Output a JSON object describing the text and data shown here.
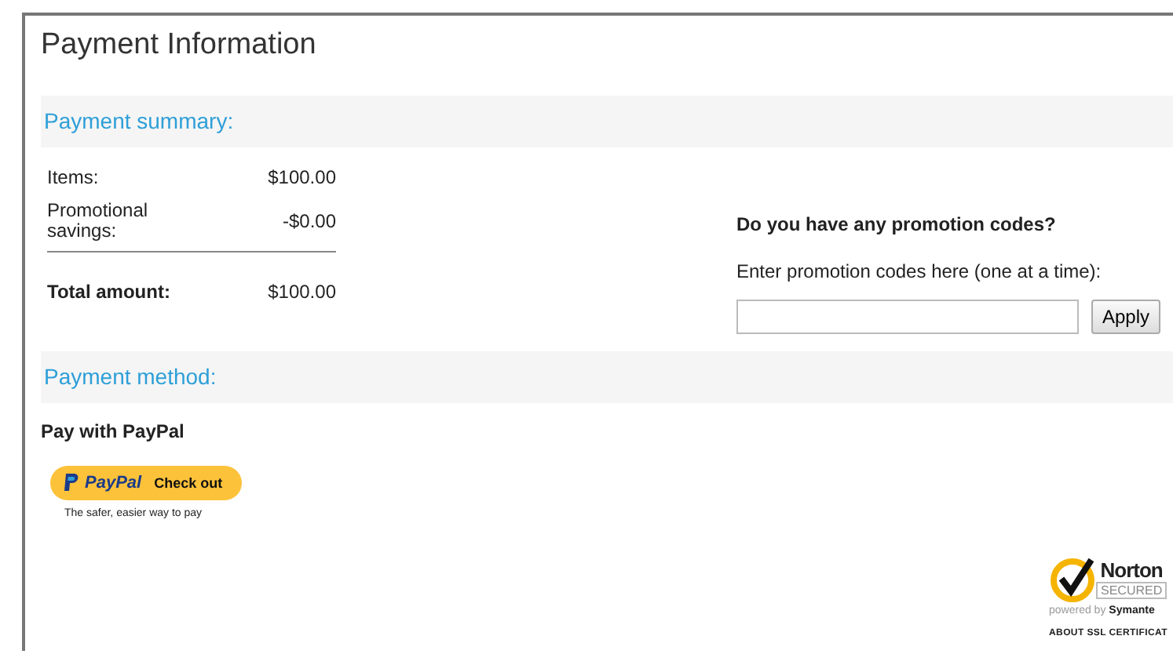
{
  "title": "Payment Information",
  "summary": {
    "heading": "Payment summary:",
    "rows": [
      {
        "label": "Items:",
        "value": "$100.00",
        "kind": "line"
      },
      {
        "label": "Promotional savings:",
        "value": "-$0.00",
        "kind": "line"
      },
      {
        "label": "Total amount:",
        "value": "$100.00",
        "kind": "total"
      }
    ]
  },
  "promo": {
    "question": "Do you have any promotion codes?",
    "instruction": "Enter promotion codes here (one at a time):",
    "button": "Apply"
  },
  "method": {
    "heading": "Payment method:",
    "option": "Pay with PayPal",
    "paypal_logo": "PayPal",
    "paypal_button": "Check out",
    "paypal_tagline": "The safer, easier way to pay"
  },
  "seal": {
    "brand": "Norton",
    "secured": "SECURED",
    "powered": "powered by",
    "company": "Symante",
    "link": "ABOUT SSL CERTIFICAT"
  }
}
